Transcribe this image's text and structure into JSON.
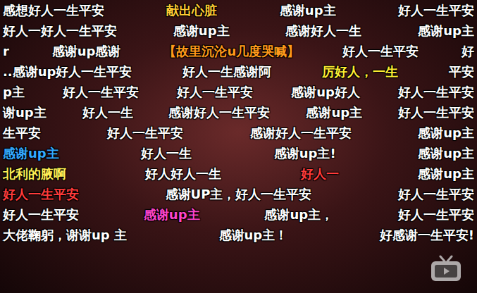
{
  "danmaku_rows": [
    [
      {
        "text": "感想好人一生平安",
        "color": "#ffffff"
      },
      {
        "text": "献出心脏",
        "color": "#ffcc33"
      },
      {
        "text": "感谢up主",
        "color": "#ffffff"
      },
      {
        "text": "好人一生平安",
        "color": "#ffffff"
      }
    ],
    [
      {
        "text": "好人一好人一生平安",
        "color": "#ffffff"
      },
      {
        "text": "感谢up主",
        "color": "#ffffff"
      },
      {
        "text": "感谢好人一生",
        "color": "#ffffff"
      },
      {
        "text": "感谢up主",
        "color": "#ffffff"
      }
    ],
    [
      {
        "text": "r",
        "color": "#ffffff"
      },
      {
        "text": "感谢up感谢",
        "color": "#ffffff"
      },
      {
        "text": "【故里沉沦u几度哭喊】",
        "color": "#ff9a1a"
      },
      {
        "text": "好人一生平安",
        "color": "#ffffff"
      },
      {
        "text": "好",
        "color": "#ffffff"
      }
    ],
    [
      {
        "text": "..感谢up好人一生平安",
        "color": "#ffffff"
      },
      {
        "text": "好人一生感谢阿",
        "color": "#ffffff"
      },
      {
        "text": "厉好人，一生",
        "color": "#ffee33"
      },
      {
        "text": "平安",
        "color": "#ffffff"
      }
    ],
    [
      {
        "text": "p主",
        "color": "#ffffff"
      },
      {
        "text": "好人一生平安",
        "color": "#ffffff"
      },
      {
        "text": "好人一生平安",
        "color": "#ffffff"
      },
      {
        "text": "感谢up好人",
        "color": "#ffffff"
      },
      {
        "text": "好人一生平安",
        "color": "#ffffff"
      }
    ],
    [
      {
        "text": "谢up主",
        "color": "#ffffff"
      },
      {
        "text": "好人一生",
        "color": "#ffffff"
      },
      {
        "text": "感谢好人一生平安",
        "color": "#ffffff"
      },
      {
        "text": "感谢up主",
        "color": "#ffffff"
      },
      {
        "text": "好人一生平安",
        "color": "#ffffff"
      }
    ],
    [
      {
        "text": "生平安",
        "color": "#ffffff"
      },
      {
        "text": "好人一生平安",
        "color": "#ffffff"
      },
      {
        "text": "感谢好人一生平安",
        "color": "#ffffff"
      },
      {
        "text": "感谢up主",
        "color": "#ffffff"
      }
    ],
    [
      {
        "text": "感谢up主",
        "color": "#33aaff"
      },
      {
        "text": "好人一生",
        "color": "#ffffff"
      },
      {
        "text": "感谢up主!",
        "color": "#ffffff"
      },
      {
        "text": "感谢up主",
        "color": "#ffffff"
      }
    ],
    [
      {
        "text": "北利的腋啊",
        "color": "#ffee55"
      },
      {
        "text": "好人好人一生",
        "color": "#ffffff"
      },
      {
        "text": "好人一",
        "color": "#ff3b3b"
      },
      {
        "text": "感谢up主",
        "color": "#ffffff"
      }
    ],
    [
      {
        "text": "好人一生平安",
        "color": "#ff3b3b"
      },
      {
        "text": "感谢UP主，好人一生平安",
        "color": "#ffffff"
      },
      {
        "text": "好人一生平安",
        "color": "#ffffff"
      }
    ],
    [
      {
        "text": "好人一生平安",
        "color": "#ffffff"
      },
      {
        "text": "感谢up主",
        "color": "#ff44cc"
      },
      {
        "text": "感谢up主，",
        "color": "#ffffff"
      },
      {
        "text": "好人一生平安",
        "color": "#ffffff"
      }
    ],
    [
      {
        "text": "大佬鞠躬，谢谢up 主",
        "color": "#ffffff"
      },
      {
        "text": "感谢up主！",
        "color": "#ffffff"
      },
      {
        "text": "好感谢一生平安!",
        "color": "#ffffff"
      }
    ]
  ]
}
